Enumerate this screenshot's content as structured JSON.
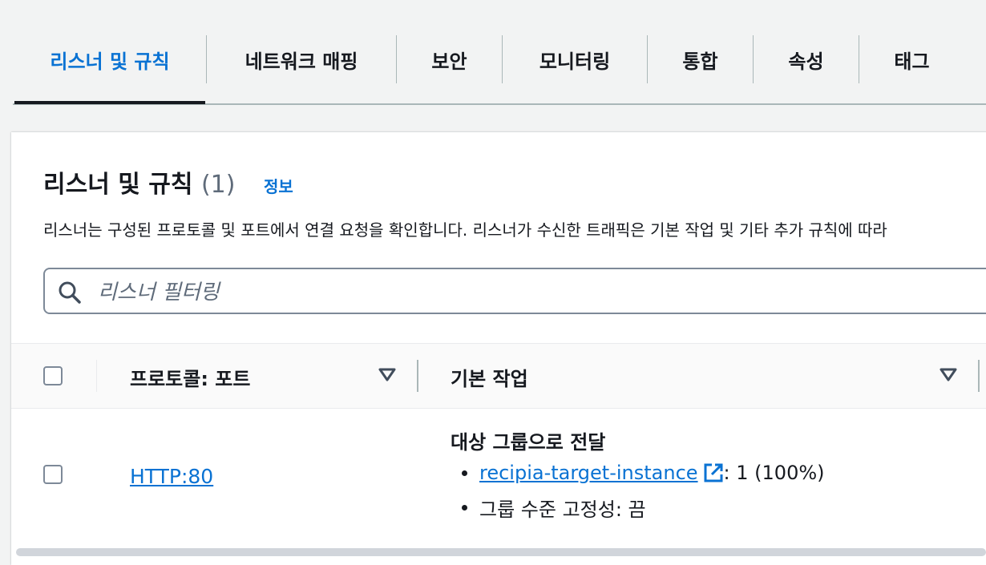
{
  "tabs": [
    {
      "label": "리스너 및 규칙",
      "active": true
    },
    {
      "label": "네트워크 매핑"
    },
    {
      "label": "보안"
    },
    {
      "label": "모니터링"
    },
    {
      "label": "통합"
    },
    {
      "label": "속성"
    },
    {
      "label": "태그"
    }
  ],
  "panel": {
    "title": "리스너 및 규칙",
    "count": "(1)",
    "info_label": "정보",
    "description": "리스너는 구성된 프로토콜 및 포트에서 연결 요청을 확인합니다. 리스너가 수신한 트래픽은 기본 작업 및 기타 추가 규칙에 따라"
  },
  "search": {
    "placeholder": "리스너 필터링",
    "value": ""
  },
  "table": {
    "columns": [
      "프로토콜: 포트",
      "기본 작업"
    ],
    "rows": [
      {
        "protocol_port": "HTTP:80",
        "action_title": "대상 그룹으로 전달",
        "target_group": "recipia-target-instance",
        "target_weight": ": 1 (100%)",
        "stickiness": "그룹 수준 고정성: 끔"
      }
    ]
  },
  "colors": {
    "accent": "#0972d3",
    "text": "#16191f",
    "border": "#7d8998"
  },
  "icons": [
    "search-icon",
    "sort-down-icon",
    "external-link-icon"
  ]
}
